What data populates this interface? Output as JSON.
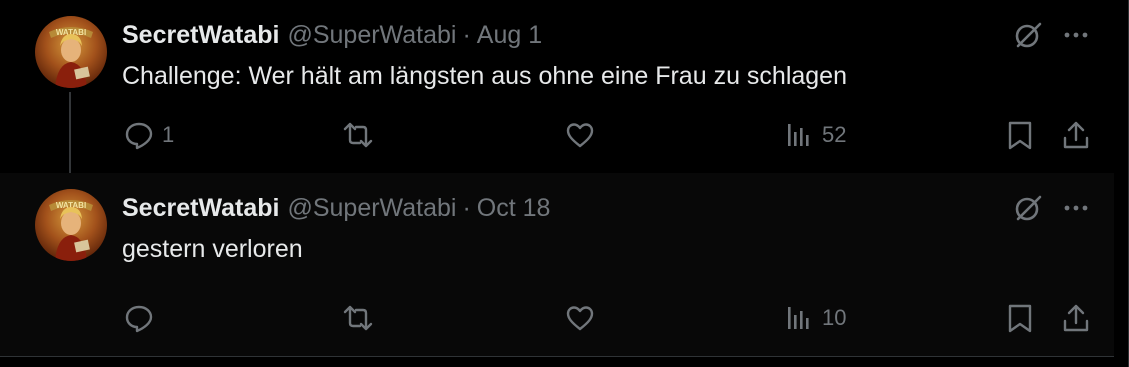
{
  "tweets": [
    {
      "name": "SecretWatabi",
      "handle": "@SuperWatabi",
      "separator": "·",
      "date": "Aug 1",
      "text": "Challenge: Wer hält am längsten aus ohne eine Frau zu schlagen",
      "avatar_text": "WATABI",
      "reply_count": "1",
      "views": "52"
    },
    {
      "name": "SecretWatabi",
      "handle": "@SuperWatabi",
      "separator": "·",
      "date": "Oct 18",
      "text": "gestern verloren",
      "avatar_text": "WATABI",
      "reply_count": "",
      "views": "10"
    }
  ],
  "icons": {
    "reply": "reply-icon",
    "retweet": "retweet-icon",
    "like": "heart-icon",
    "views": "views-chart-icon",
    "bookmark": "bookmark-icon",
    "share": "share-icon",
    "grok": "grok-icon",
    "more": "more-dots-icon"
  },
  "colors": {
    "background": "#000000",
    "text_primary": "#e7e9ea",
    "text_secondary": "#71767b",
    "border": "#2f3336"
  }
}
